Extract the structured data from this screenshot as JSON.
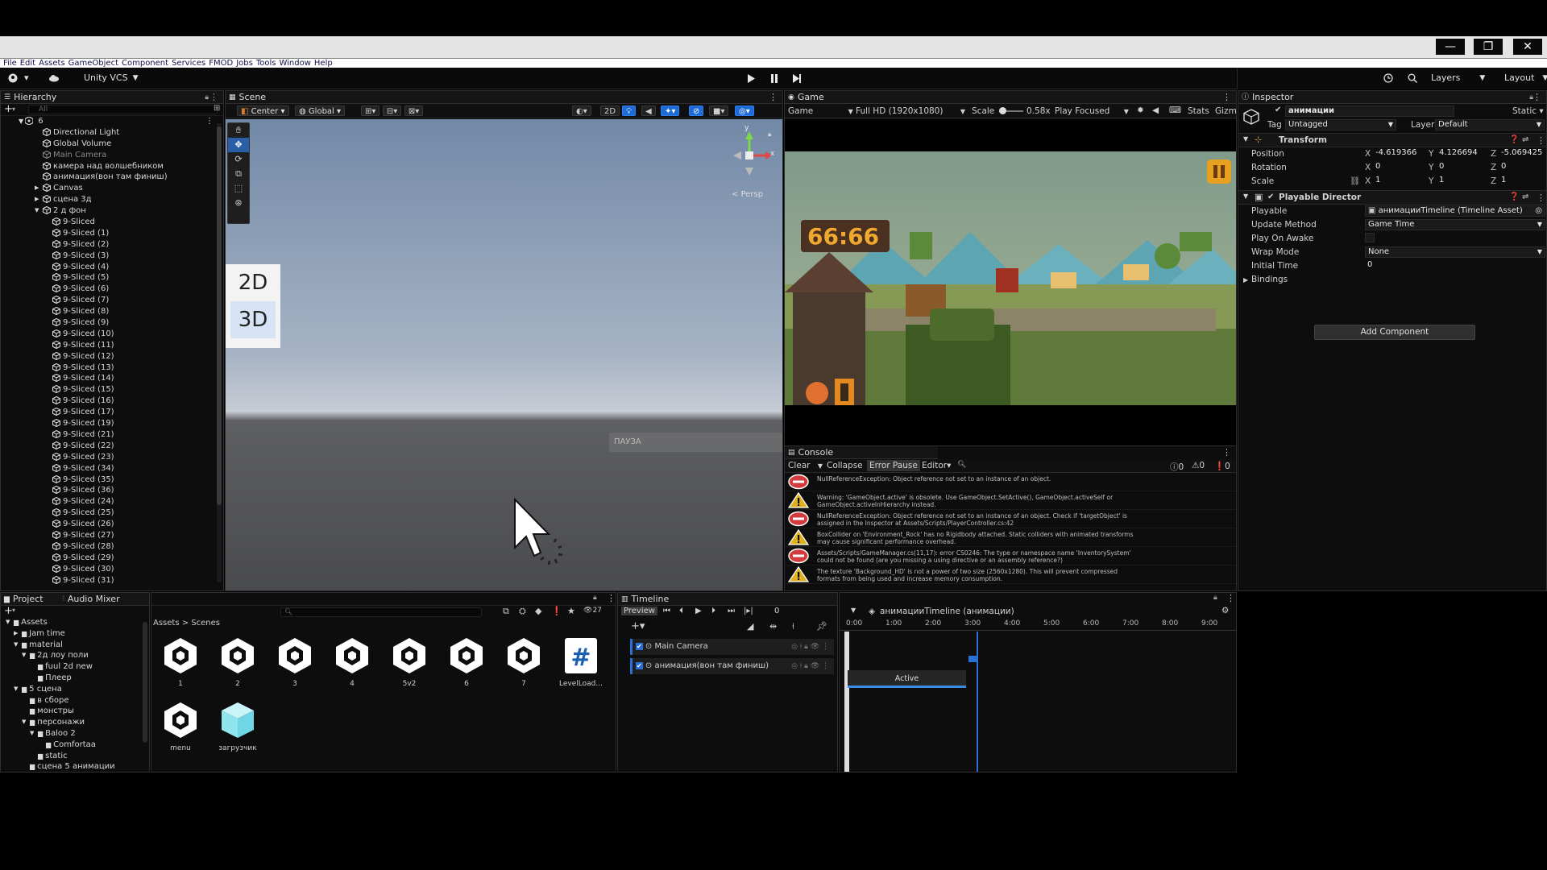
{
  "window": {
    "minimize_glyph": "—",
    "restore_glyph": "❐",
    "close_glyph": "✕"
  },
  "menu": [
    "File",
    "Edit",
    "Assets",
    "GameObject",
    "Component",
    "Services",
    "FMOD",
    "Jobs",
    "Tools",
    "Window",
    "Help"
  ],
  "toolbar": {
    "vcs_label": "Unity VCS",
    "layers_label": "Layers",
    "layout_label": "Layout"
  },
  "hierarchy": {
    "tab_label": "Hierarchy",
    "search_placeholder": "All",
    "scene_name": "6",
    "items": [
      {
        "label": "Directional Light",
        "indent": 2,
        "dim": false,
        "arrow": ""
      },
      {
        "label": "Global Volume",
        "indent": 2,
        "dim": false,
        "arrow": ""
      },
      {
        "label": "Main Camera",
        "indent": 2,
        "dim": true,
        "arrow": ""
      },
      {
        "label": "камера над волшебником",
        "indent": 2,
        "dim": false,
        "arrow": ""
      },
      {
        "label": "анимация(вон там финиш)",
        "indent": 2,
        "dim": false,
        "arrow": ""
      },
      {
        "label": "Canvas",
        "indent": 2,
        "dim": false,
        "arrow": "▶"
      },
      {
        "label": "сцена 3д",
        "indent": 2,
        "dim": false,
        "arrow": "▶"
      },
      {
        "label": "2 д фон",
        "indent": 2,
        "dim": false,
        "arrow": "▼"
      },
      {
        "label": "9-Sliced",
        "indent": 3,
        "dim": false,
        "arrow": ""
      },
      {
        "label": "9-Sliced (1)",
        "indent": 3,
        "dim": false,
        "arrow": ""
      },
      {
        "label": "9-Sliced (2)",
        "indent": 3,
        "dim": false,
        "arrow": ""
      },
      {
        "label": "9-Sliced (3)",
        "indent": 3,
        "dim": false,
        "arrow": ""
      },
      {
        "label": "9-Sliced (4)",
        "indent": 3,
        "dim": false,
        "arrow": ""
      },
      {
        "label": "9-Sliced (5)",
        "indent": 3,
        "dim": false,
        "arrow": ""
      },
      {
        "label": "9-Sliced (6)",
        "indent": 3,
        "dim": false,
        "arrow": ""
      },
      {
        "label": "9-Sliced (7)",
        "indent": 3,
        "dim": false,
        "arrow": ""
      },
      {
        "label": "9-Sliced (8)",
        "indent": 3,
        "dim": false,
        "arrow": ""
      },
      {
        "label": "9-Sliced (9)",
        "indent": 3,
        "dim": false,
        "arrow": ""
      },
      {
        "label": "9-Sliced (10)",
        "indent": 3,
        "dim": false,
        "arrow": ""
      },
      {
        "label": "9-Sliced (11)",
        "indent": 3,
        "dim": false,
        "arrow": ""
      },
      {
        "label": "9-Sliced (12)",
        "indent": 3,
        "dim": false,
        "arrow": ""
      },
      {
        "label": "9-Sliced (13)",
        "indent": 3,
        "dim": false,
        "arrow": ""
      },
      {
        "label": "9-Sliced (14)",
        "indent": 3,
        "dim": false,
        "arrow": ""
      },
      {
        "label": "9-Sliced (15)",
        "indent": 3,
        "dim": false,
        "arrow": ""
      },
      {
        "label": "9-Sliced (16)",
        "indent": 3,
        "dim": false,
        "arrow": ""
      },
      {
        "label": "9-Sliced (17)",
        "indent": 3,
        "dim": false,
        "arrow": ""
      },
      {
        "label": "9-Sliced (19)",
        "indent": 3,
        "dim": false,
        "arrow": ""
      },
      {
        "label": "9-Sliced (21)",
        "indent": 3,
        "dim": false,
        "arrow": ""
      },
      {
        "label": "9-Sliced (22)",
        "indent": 3,
        "dim": false,
        "arrow": ""
      },
      {
        "label": "9-Sliced (23)",
        "indent": 3,
        "dim": false,
        "arrow": ""
      },
      {
        "label": "9-Sliced (34)",
        "indent": 3,
        "dim": false,
        "arrow": ""
      },
      {
        "label": "9-Sliced (35)",
        "indent": 3,
        "dim": false,
        "arrow": ""
      },
      {
        "label": "9-Sliced (36)",
        "indent": 3,
        "dim": false,
        "arrow": ""
      },
      {
        "label": "9-Sliced (24)",
        "indent": 3,
        "dim": false,
        "arrow": ""
      },
      {
        "label": "9-Sliced (25)",
        "indent": 3,
        "dim": false,
        "arrow": ""
      },
      {
        "label": "9-Sliced (26)",
        "indent": 3,
        "dim": false,
        "arrow": ""
      },
      {
        "label": "9-Sliced (27)",
        "indent": 3,
        "dim": false,
        "arrow": ""
      },
      {
        "label": "9-Sliced (28)",
        "indent": 3,
        "dim": false,
        "arrow": ""
      },
      {
        "label": "9-Sliced (29)",
        "indent": 3,
        "dim": false,
        "arrow": ""
      },
      {
        "label": "9-Sliced (30)",
        "indent": 3,
        "dim": false,
        "arrow": ""
      },
      {
        "label": "9-Sliced (31)",
        "indent": 3,
        "dim": false,
        "arrow": ""
      }
    ]
  },
  "scene": {
    "tab_label": "Scene",
    "pivot_label": "Center",
    "space_label": "Global",
    "mode_2d": "2D",
    "persp_label": "< Persp",
    "axis_y": "y",
    "axis_x": "x",
    "overlay_2d": "2D",
    "overlay_3d": "3D",
    "ghost_text": "ПАУЗА"
  },
  "game": {
    "tab_label": "Game",
    "display": "Game",
    "resolution": "Full HD (1920x1080)",
    "scale_label": "Scale",
    "scale_value": "0.58x",
    "play_mode": "Play Focused",
    "stats_label": "Stats",
    "gizmos_label": "Gizmos",
    "timer": "66:66"
  },
  "console": {
    "tab_label": "Console",
    "clear": "Clear",
    "collapse": "Collapse",
    "error_pause": "Error Pause",
    "editor": "Editor",
    "counts": [
      "0",
      "0",
      "0"
    ],
    "messages": [
      {
        "type": "error",
        "text": "NullReferenceException: Object reference not set to an instance of an object."
      },
      {
        "type": "warning",
        "text": "Warning: 'GameObject.active' is obsolete. Use GameObject.SetActive(), GameObject.activeSelf or GameObject.activeInHierarchy instead."
      },
      {
        "type": "error",
        "text": "NullReferenceException: Object reference not set to an instance of an object. Check if 'targetObject' is assigned in the Inspector at Assets/Scripts/PlayerController.cs:42"
      },
      {
        "type": "warning",
        "text": "BoxCollider on 'Environment_Rock' has no Rigidbody attached. Static colliders with animated transforms may cause significant performance overhead."
      },
      {
        "type": "error",
        "text": "Assets/Scripts/GameManager.cs(11,17): error CS0246: The type or namespace name 'InventorySystem' could not be found (are you missing a using directive or an assembly reference?)"
      },
      {
        "type": "warning",
        "text": "The texture 'Background_HD' is not a power of two size (2560x1280). This will prevent compressed formats from being used and increase memory consumption."
      }
    ]
  },
  "inspector": {
    "tab_label": "Inspector",
    "object_name": "анимации",
    "static_label": "Static",
    "tag_label": "Tag",
    "tag_value": "Untagged",
    "layer_label": "Layer",
    "layer_value": "Default",
    "transform": {
      "title": "Transform",
      "position_label": "Position",
      "rotation_label": "Rotation",
      "scale_label": "Scale",
      "px": "-4.619366",
      "py": "4.126694",
      "pz": "-5.069425",
      "rx": "0",
      "ry": "0",
      "rz": "0",
      "sx": "1",
      "sy": "1",
      "sz": "1"
    },
    "director": {
      "title": "Playable Director",
      "playable_label": "Playable",
      "playable_value": "анимацииTimeline (Timeline Asset)",
      "update_label": "Update Method",
      "update_value": "Game Time",
      "awake_label": "Play On Awake",
      "wrap_label": "Wrap Mode",
      "wrap_value": "None",
      "initial_label": "Initial Time",
      "initial_value": "0",
      "bindings_label": "Bindings"
    },
    "add_component": "Add Component"
  },
  "project": {
    "tab_project": "Project",
    "tab_audio": "Audio Mixer",
    "count": "27",
    "breadcrumb_root": "Assets",
    "breadcrumb_sep": ">",
    "breadcrumb_leaf": "Scenes",
    "tree": [
      {
        "label": "Assets",
        "indent": 0,
        "arrow": "▼"
      },
      {
        "label": "Jam time",
        "indent": 1,
        "arrow": "▶"
      },
      {
        "label": "material",
        "indent": 1,
        "arrow": "▼"
      },
      {
        "label": "2д лоу поли",
        "indent": 2,
        "arrow": "▼"
      },
      {
        "label": "fuul 2d new",
        "indent": 3,
        "arrow": ""
      },
      {
        "label": "Плеер",
        "indent": 3,
        "arrow": ""
      },
      {
        "label": "5 сцена",
        "indent": 1,
        "arrow": "▼"
      },
      {
        "label": "в сборе",
        "indent": 2,
        "arrow": ""
      },
      {
        "label": "монстры",
        "indent": 2,
        "arrow": ""
      },
      {
        "label": "персонажи",
        "indent": 2,
        "arrow": "▼"
      },
      {
        "label": "Baloo 2",
        "indent": 3,
        "arrow": "▼"
      },
      {
        "label": "Comfortaa",
        "indent": 4,
        "arrow": ""
      },
      {
        "label": "static",
        "indent": 3,
        "arrow": ""
      },
      {
        "label": "сцена 5 анимации",
        "indent": 2,
        "arrow": ""
      }
    ],
    "assets": [
      {
        "label": "1",
        "kind": "unity"
      },
      {
        "label": "2",
        "kind": "unity"
      },
      {
        "label": "3",
        "kind": "unity"
      },
      {
        "label": "4",
        "kind": "unity"
      },
      {
        "label": "5v2",
        "kind": "unity"
      },
      {
        "label": "6",
        "kind": "unity"
      },
      {
        "label": "7",
        "kind": "unity"
      },
      {
        "label": "LevelLoad...",
        "kind": "script"
      },
      {
        "label": "menu",
        "kind": "unity"
      },
      {
        "label": "загрузчик",
        "kind": "cube"
      }
    ]
  },
  "timeline": {
    "tab_label": "Timeline",
    "preview": "Preview",
    "frame": "0",
    "asset_title": "анимацииTimeline (анимации)",
    "ruler": [
      "0:00",
      "1:00",
      "2:00",
      "3:00",
      "4:00",
      "5:00",
      "6:00",
      "7:00",
      "8:00",
      "9:00"
    ],
    "tracks": [
      "Main Camera",
      "анимация(вон там финиш)"
    ],
    "clip_label": "Active"
  },
  "colors": {
    "accent": "#1e6ad6",
    "error": "#d23b3b",
    "warning": "#e0b020",
    "clip": "#2a5fa8"
  }
}
